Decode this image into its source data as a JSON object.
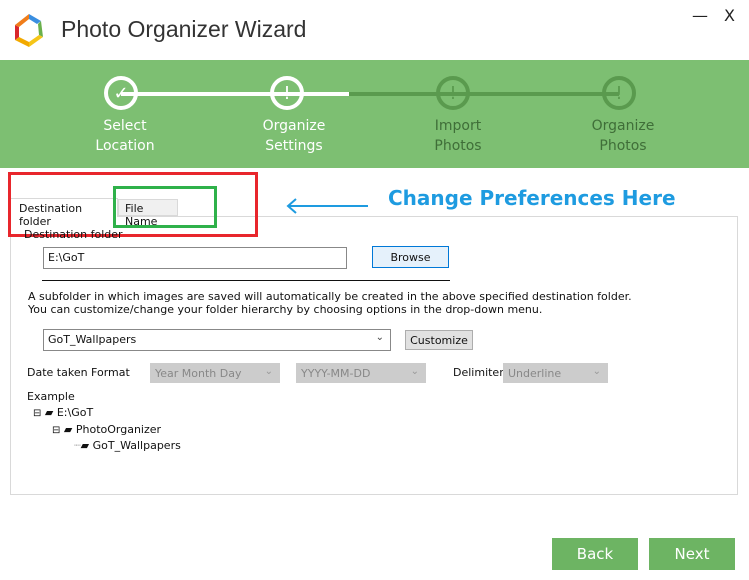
{
  "window": {
    "title": "Photo Organizer Wizard",
    "minimize": "—",
    "close": "X"
  },
  "steps": [
    {
      "line1": "Select",
      "line2": "Location",
      "icon": "✓",
      "state": "done"
    },
    {
      "line1": "Organize",
      "line2": "Settings",
      "icon": "!",
      "state": "current"
    },
    {
      "line1": "Import",
      "line2": "Photos",
      "icon": "!",
      "state": "pending"
    },
    {
      "line1": "Organize",
      "line2": "Photos",
      "icon": "!",
      "state": "pending"
    }
  ],
  "tabs": [
    {
      "label": "Destination folder",
      "active": true
    },
    {
      "label": "File Name",
      "active": false
    }
  ],
  "annotation": {
    "text": "Change Preferences Here",
    "color": "#1e9be0"
  },
  "destination": {
    "label": "Destination folder",
    "value": "E:\\GoT",
    "browse": "Browse"
  },
  "info": {
    "line1": "A subfolder in which images are saved will automatically be created in the above specified destination folder.",
    "line2": "You can customize/change your folder hierarchy by choosing options in the drop-down menu."
  },
  "hierarchy": {
    "selected": "GoT_Wallpapers",
    "customize": "Customize"
  },
  "date": {
    "label": "Date taken Format",
    "order": "Year Month Day",
    "format": "YYYY-MM-DD",
    "delimiter_label": "Delimiter",
    "delimiter": "Underline"
  },
  "example": {
    "label": "Example",
    "tree": [
      "E:\\GoT",
      "PhotoOrganizer",
      "GoT_Wallpapers"
    ]
  },
  "footer": {
    "back": "Back",
    "next": "Next"
  },
  "colors": {
    "band": "#7dbf72",
    "button": "#6db463",
    "pending": "#5a9a4e"
  }
}
